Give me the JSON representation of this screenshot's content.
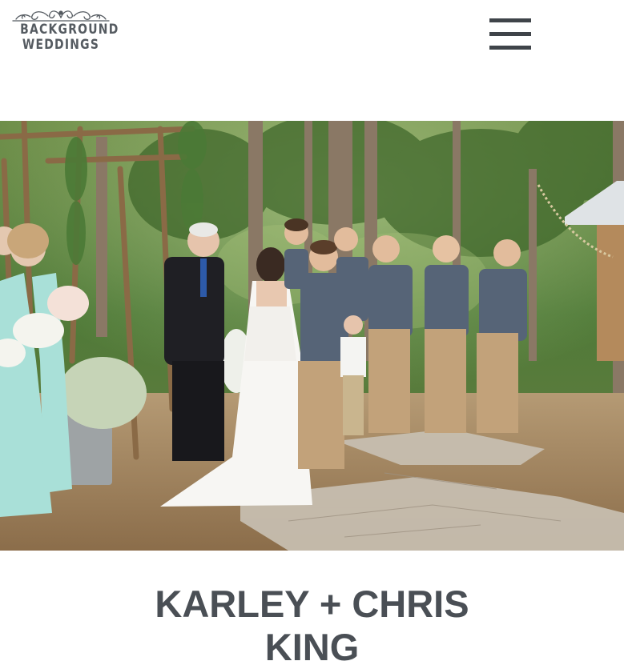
{
  "logo": {
    "line1": "BACKGROUND",
    "line2": "WEDDINGS",
    "ornament_icon": "flourish-ornament-icon"
  },
  "header": {
    "menu_icon": "hamburger-menu-icon"
  },
  "hero": {
    "image_subject": "outdoor-wedding-ceremony-photo"
  },
  "post": {
    "title_line1": "KARLEY + CHRIS",
    "title_line2": "KING"
  },
  "colors": {
    "text": "#4a4f55",
    "logo": "#555b61",
    "menu": "#3f4449",
    "background": "#ffffff"
  }
}
